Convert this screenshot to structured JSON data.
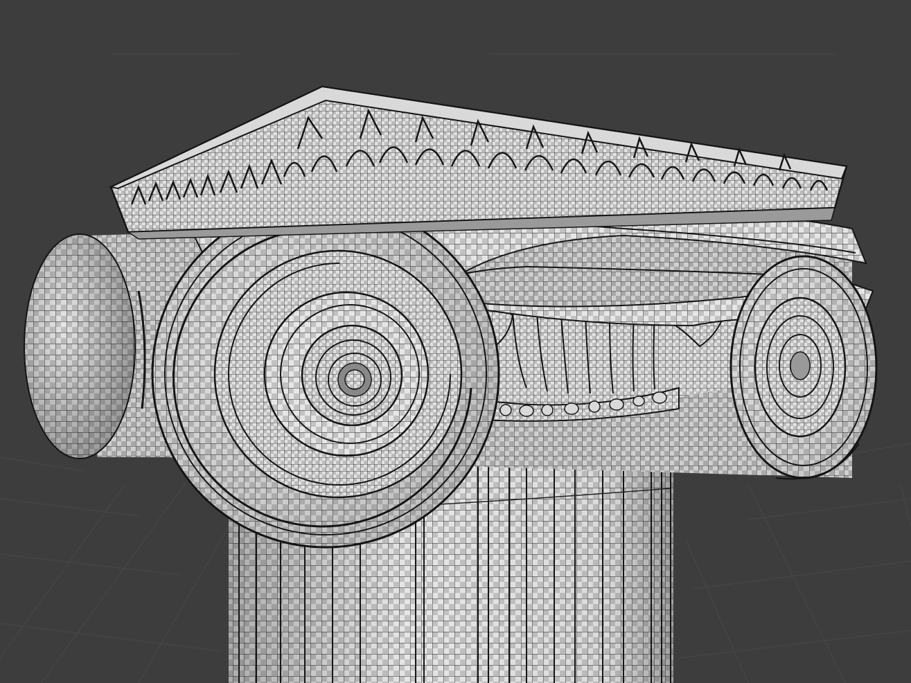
{
  "viewport": {
    "view": "3d-viewport",
    "display_mode": "wireframe-on-checker",
    "background_color": "#3d3d3d",
    "grid_color": "#4a4a4a",
    "model": "ionic-column-capital",
    "components": [
      "grid-floor",
      "column-shaft",
      "fluting",
      "left-volute-scroll",
      "right-volute-scroll",
      "echinus",
      "egg-and-dart-band",
      "abacus",
      "abacus-ornament"
    ]
  },
  "colors": {
    "mesh_light": "#e6e6e6",
    "mesh_dark": "#bdbdbd",
    "wire": "#1c1c1c",
    "shadow": "#7c7c7c"
  }
}
